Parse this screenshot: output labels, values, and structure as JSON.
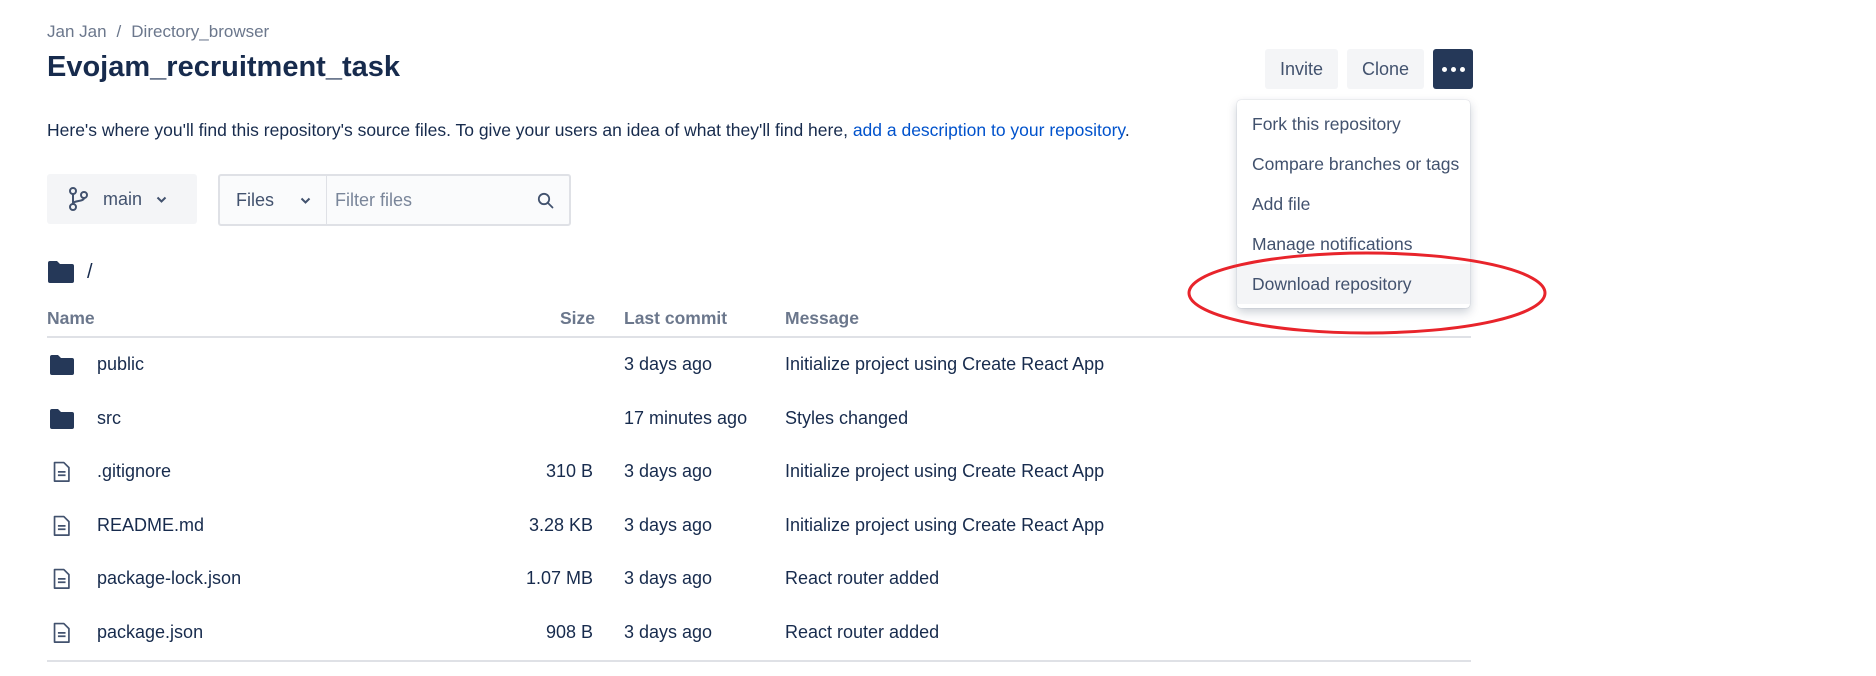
{
  "breadcrumb": {
    "owner": "Jan Jan",
    "separator": "/",
    "repo": "Directory_browser"
  },
  "title": "Evojam_recruitment_task",
  "header_actions": {
    "invite": "Invite",
    "clone": "Clone",
    "more_icon": "ellipsis-icon"
  },
  "description": {
    "text": "Here's where you'll find this repository's source files. To give your users an idea of what they'll find here,",
    "link": "add a description to your repository",
    "end": "."
  },
  "branch": {
    "icon": "branch-icon",
    "name": "main"
  },
  "filter": {
    "select_label": "Files",
    "placeholder": "Filter files",
    "value": ""
  },
  "path": {
    "icon": "folder-icon",
    "text": "/"
  },
  "table": {
    "headers": {
      "name": "Name",
      "size": "Size",
      "last_commit": "Last commit",
      "message": "Message"
    },
    "rows": [
      {
        "type": "folder",
        "name": "public",
        "size": "",
        "last_commit": "3 days ago",
        "message": "Initialize project using Create React App"
      },
      {
        "type": "folder",
        "name": "src",
        "size": "",
        "last_commit": "17 minutes ago",
        "message": "Styles changed"
      },
      {
        "type": "file",
        "name": ".gitignore",
        "size": "310 B",
        "last_commit": "3 days ago",
        "message": "Initialize project using Create React App"
      },
      {
        "type": "file",
        "name": "README.md",
        "size": "3.28 KB",
        "last_commit": "3 days ago",
        "message": "Initialize project using Create React App"
      },
      {
        "type": "file",
        "name": "package-lock.json",
        "size": "1.07 MB",
        "last_commit": "3 days ago",
        "message": "React router added"
      },
      {
        "type": "file",
        "name": "package.json",
        "size": "908 B",
        "last_commit": "3 days ago",
        "message": "React router added"
      }
    ]
  },
  "dropdown": {
    "items": [
      {
        "label": "Fork this repository"
      },
      {
        "label": "Compare branches or tags"
      },
      {
        "label": "Add file"
      },
      {
        "label": "Manage notifications"
      },
      {
        "label": "Download repository",
        "highlighted": true
      }
    ]
  },
  "colors": {
    "primary_text": "#172b4d",
    "link": "#0052cc",
    "more_button": "#253858",
    "annotation": "#e8242b"
  }
}
